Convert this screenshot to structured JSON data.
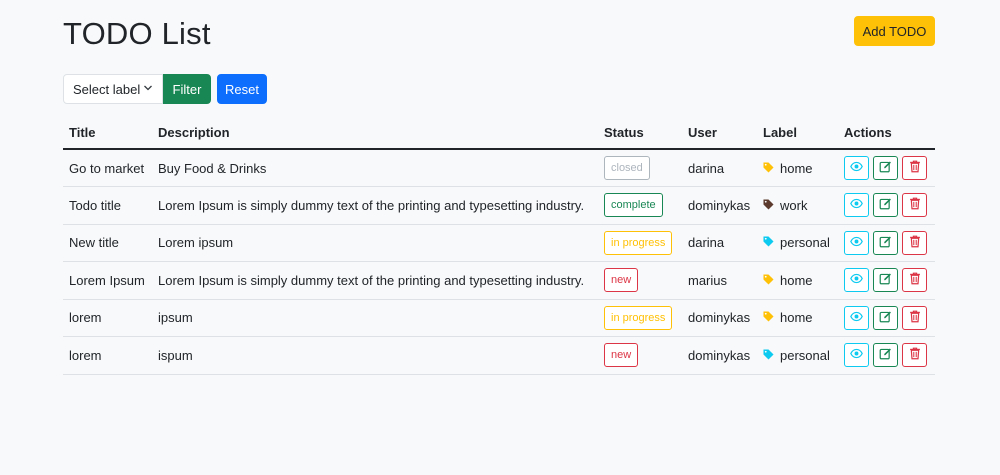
{
  "header": {
    "title": "TODO List",
    "add_button": "Add TODO"
  },
  "filter": {
    "select_value": "Select label",
    "filter_button": "Filter",
    "reset_button": "Reset"
  },
  "table": {
    "columns": [
      "Title",
      "Description",
      "Status",
      "User",
      "Label",
      "Actions"
    ],
    "rows": [
      {
        "title": "Go to market",
        "description": "Buy Food & Drinks",
        "status": "closed",
        "user": "darina",
        "label": "home",
        "label_color": "#ffc107"
      },
      {
        "title": "Todo title",
        "description": "Lorem Ipsum is simply dummy text of the printing and typesetting industry.",
        "status": "complete",
        "user": "dominykas",
        "label": "work",
        "label_color": "#5c3a2e"
      },
      {
        "title": "New title",
        "description": "Lorem ipsum",
        "status": "in progress",
        "user": "darina",
        "label": "personal",
        "label_color": "#0dcaf0"
      },
      {
        "title": "Lorem Ipsum",
        "description": "Lorem Ipsum is simply dummy text of the printing and typesetting industry.",
        "status": "new",
        "user": "marius",
        "label": "home",
        "label_color": "#ffc107"
      },
      {
        "title": "lorem",
        "description": "ipsum",
        "status": "in progress",
        "user": "dominykas",
        "label": "home",
        "label_color": "#ffc107"
      },
      {
        "title": "lorem",
        "description": "ispum",
        "status": "new",
        "user": "dominykas",
        "label": "personal",
        "label_color": "#0dcaf0"
      }
    ]
  },
  "status_colors": {
    "closed": "#adb5bd",
    "complete": "#198754",
    "in progress": "#ffc107",
    "new": "#dc3545"
  },
  "action_icons": [
    "eye-icon",
    "edit-icon",
    "trash-icon"
  ]
}
